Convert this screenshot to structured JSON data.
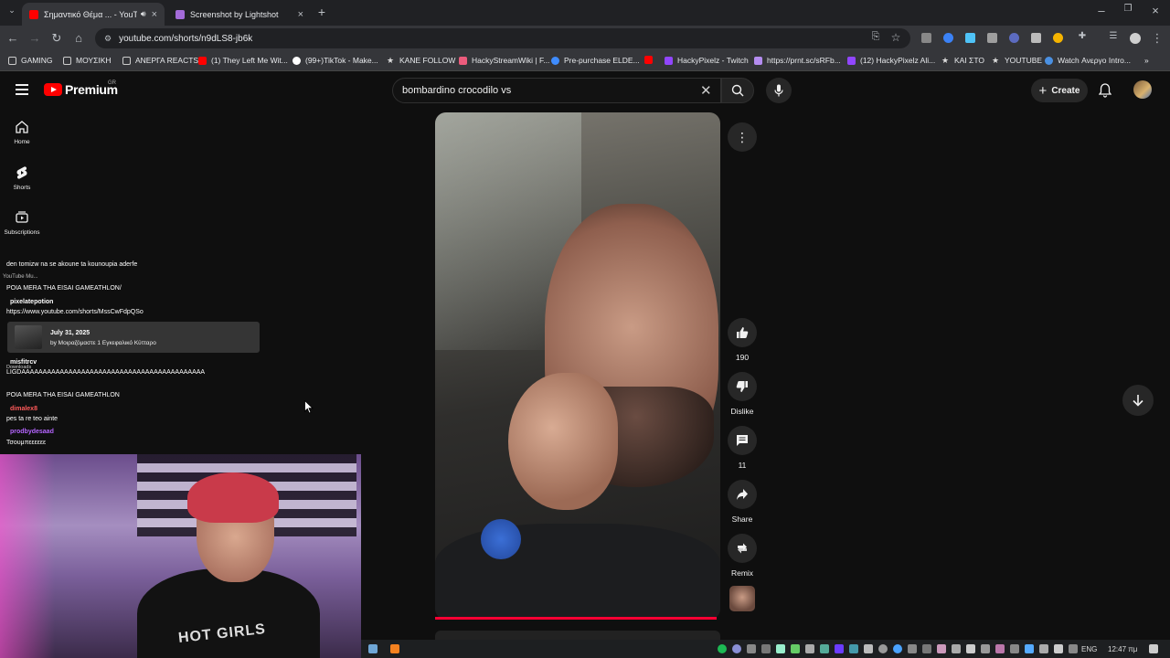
{
  "browser": {
    "tabs": [
      {
        "label": "Σημαντικό Θέμα ... - YouTube",
        "active": true
      },
      {
        "label": "Screenshot by Lightshot",
        "active": false
      }
    ],
    "url": "youtube.com/shorts/n9dLS8-jb6k",
    "bookmarks": [
      "GAMING",
      "ΜΟΥΣΙΚΗ",
      "ΑΝΕΡΓΑ REACTS",
      "(1) They Left Me Wit...",
      "(99+)TikTok - Make...",
      "KANE FOLLOW",
      "HackyStreamWiki | F...",
      "Pre-purchase ELDE...",
      "",
      "HackyPixelz - Twitch",
      "https://prnt.sc/sRFb...",
      "(12) HackyPixelz Ali...",
      "ΚΑΙ ΣΤΟ",
      "YOUTUBE",
      "Watch Ανεργο Intro..."
    ]
  },
  "youtube": {
    "logo_text": "Premium",
    "region": "GR",
    "search_query": "bombardino crocodilo vs",
    "create_label": "Create",
    "sidebar": [
      {
        "label": "Home",
        "icon": "home-icon"
      },
      {
        "label": "Shorts",
        "icon": "shorts-icon"
      },
      {
        "label": "Subscriptions",
        "icon": "subscriptions-icon"
      }
    ],
    "actions": {
      "like_count": "190",
      "dislike_label": "Dislike",
      "comment_count": "11",
      "share_label": "Share",
      "remix_label": "Remix"
    }
  },
  "chat": {
    "lines": [
      "den tomizw na se akoune ta kounoupia aderfe",
      "YouTube Mu...",
      "POIA MERA THA EISAI GAMEATHLON/",
      "pixelatepotion",
      "https://www.youtube.com/shorts/MssCwFdpQSo",
      "misfitrcv",
      "Downloads",
      "LIGDAAAAAAAAAAAAAAAAAAAAAAAAAAAAAAAAAAAAAAAAAAA",
      "POIA MERA THA EISAI GAMEATHLON",
      "dimalex8",
      "pes ta re teo ainte",
      "prodbydesaad",
      "Τσουμπεεεεεε"
    ],
    "notification": {
      "date": "July 31, 2025",
      "byline": "by Μοιραζόμαστε 1 Εγκεφαλικό Κύτταρο"
    }
  },
  "webcam": {
    "shirt_text": "HOT GIRLS"
  },
  "taskbar": {
    "language": "ENG",
    "time": "12:47 πμ"
  }
}
